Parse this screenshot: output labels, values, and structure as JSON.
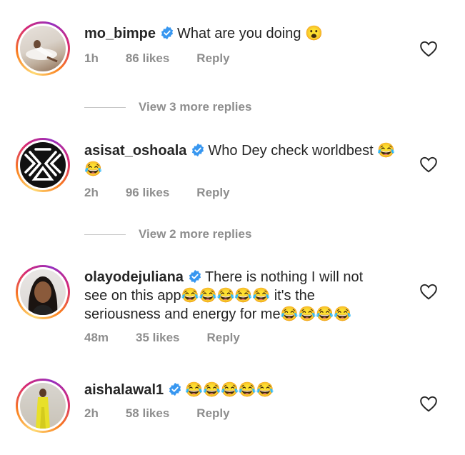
{
  "comments": [
    {
      "username": "mo_bimpe",
      "text": "What are you doing 😮",
      "time": "1h",
      "likes": "86 likes",
      "reply": "Reply",
      "view_replies": "View 3 more replies"
    },
    {
      "username": "asisat_oshoala",
      "text": "Who Dey check worldbest 😂😂",
      "time": "2h",
      "likes": "96 likes",
      "reply": "Reply",
      "view_replies": "View 2 more replies"
    },
    {
      "username": "olayodejuliana",
      "text": "There is nothing I will not see on this app😂😂😂😂😂 it's the seriousness and energy for me😂😂😂😂",
      "time": "48m",
      "likes": "35 likes",
      "reply": "Reply"
    },
    {
      "username": "aishalawal1",
      "text": "😂😂😂😂😂",
      "time": "2h",
      "likes": "58 likes",
      "reply": "Reply"
    }
  ],
  "icons": {
    "verified": "verified-badge-icon",
    "like": "heart-outline-icon"
  },
  "colors": {
    "verified": "#3897f0",
    "meta": "#8e8e8e",
    "text": "#262626"
  }
}
